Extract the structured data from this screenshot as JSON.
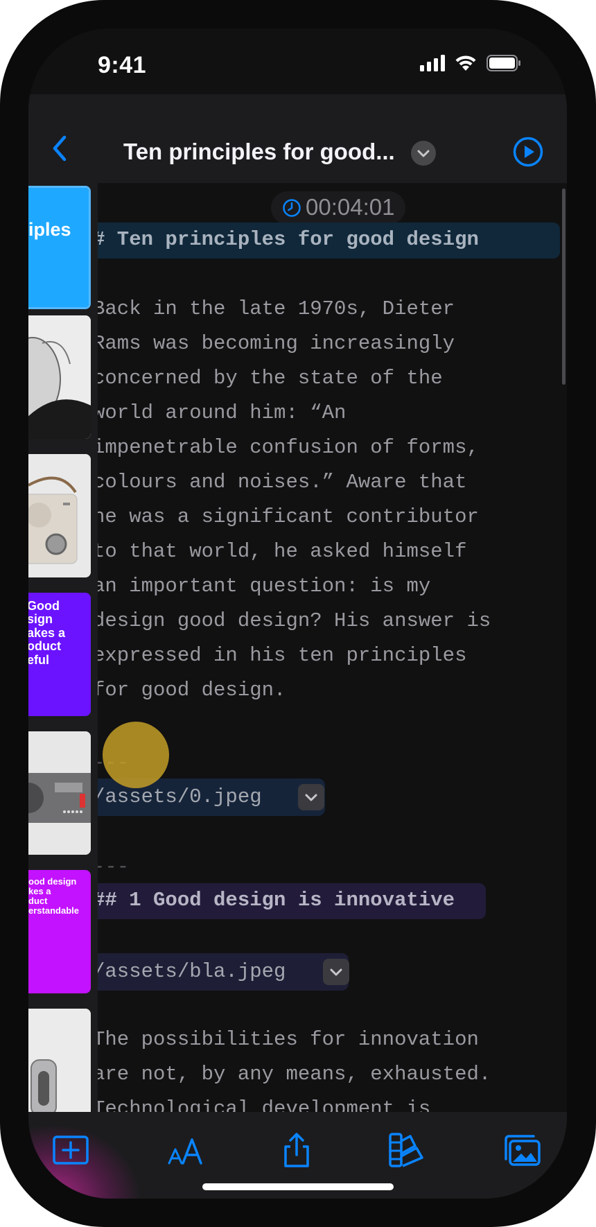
{
  "status_bar": {
    "time": "9:41"
  },
  "nav": {
    "title": "Ten principles for good..."
  },
  "timer": {
    "value": "00:04:01"
  },
  "slides": [
    {
      "text": "iples",
      "bg": "#1fa8ff"
    },
    {
      "text": "",
      "bg": "#ececec"
    },
    {
      "text": "",
      "bg": "#e9e9e9"
    },
    {
      "text": "Good\nsign\nakes a\noduct\neful",
      "bg": "#6b13ff"
    },
    {
      "text": "",
      "bg": "#e7e7e7"
    },
    {
      "text": "ood design\nkes a\nduct\nerstandable",
      "bg": "#c312ff"
    },
    {
      "text": "",
      "bg": "#ebebeb"
    }
  ],
  "editor": {
    "heading1": "# Ten principles for good design",
    "paragraph1": [
      "Back in the late 1970s, Dieter",
      "Rams was becoming increasingly",
      "concerned by the state of the",
      "world around him: “An",
      "impenetrable confusion of forms,",
      "colours and noises.” Aware that",
      "he was a significant contributor",
      "to that world, he asked himself",
      "an important question: is my",
      "design good design? His answer is",
      "expressed in his ten principles",
      "for good design."
    ],
    "separator": "---",
    "image1": "/assets/0.jpeg",
    "heading2": "## 1 Good design is innovative",
    "image2": "/assets/bla.jpeg",
    "paragraph2": [
      "The possibilities for innovation",
      "are not, by any means, exhausted.",
      "Technological development is"
    ]
  },
  "colors": {
    "accent": "#0a84ff",
    "heading1_bg": "#10283a",
    "heading2_bg": "#221c3a",
    "chip1_bg": "#16243a",
    "chip2_bg": "#1e1e36"
  },
  "toolbar": [
    "add-slide-icon",
    "text-size-icon",
    "share-icon",
    "theme-icon",
    "media-icon"
  ]
}
